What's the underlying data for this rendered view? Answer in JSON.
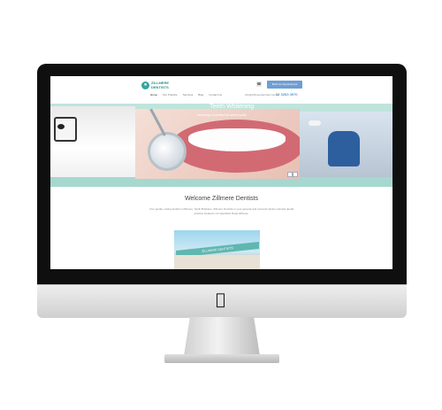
{
  "site": {
    "logo_line1": "ZILLMERE",
    "logo_line2": "DENTISTS",
    "nav": [
      "Home",
      "Our Practice",
      "Services",
      "Blog",
      "Contact Us"
    ],
    "contact_email": "info@zillmeredentists.com.au",
    "contact_phone": "07 3263 4970",
    "appointment_label": "Book an Appointment"
  },
  "slider": {
    "title": "Teeth Whitening",
    "subtitle": "Great ways to achieve the perfect smile"
  },
  "welcome": {
    "title": "Welcome Zillmere Dentists",
    "text": "Your gentle, caring dentist in Zillmere, North Brisbane. Zillmere Dentists is your general and cosmetic family oriented dental practice located in 21 Handford Road Zillmere.",
    "building_sign": "ZILLMERE DENTISTS"
  },
  "icons": {
    "apple": "apple-logo-icon",
    "header": "phone-icon"
  },
  "colors": {
    "accent_teal": "#bfe4dc",
    "button_blue": "#6f9ed3",
    "monitor_black": "#0f0f10"
  }
}
